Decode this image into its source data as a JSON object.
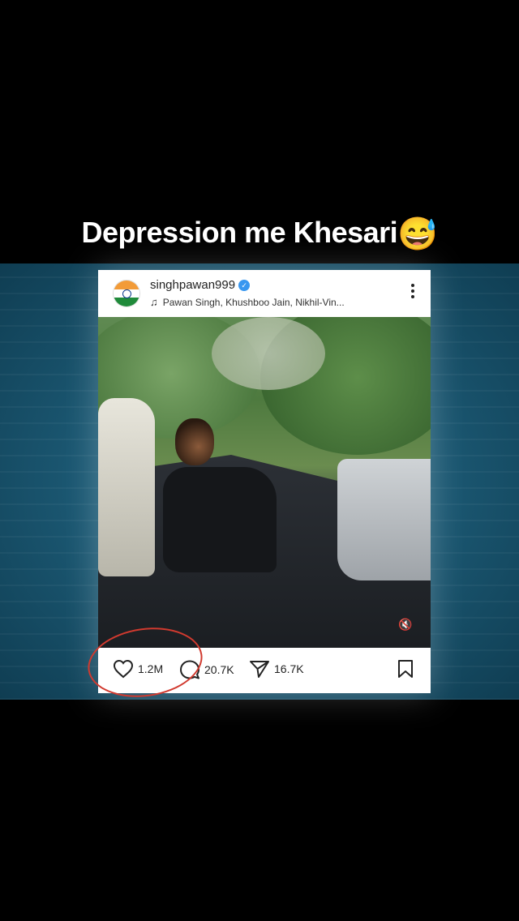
{
  "caption": {
    "text": "Depression me Khesari",
    "emoji": "😅"
  },
  "post": {
    "username": "singhpawan999",
    "verified_mark": "✓",
    "music_icon": "♫",
    "music_text": "Pawan Singh, Khushboo Jain, Nikhil-Vin...",
    "more_icon": "more-vertical-icon",
    "actions": {
      "likes": "1.2M",
      "comments": "20.7K",
      "shares": "16.7K"
    },
    "mute_icon": "🔇"
  },
  "colors": {
    "background": "#000000",
    "panel": "#1c5a75",
    "verified": "#3897f0",
    "annotation_circle": "#d13a2f"
  }
}
